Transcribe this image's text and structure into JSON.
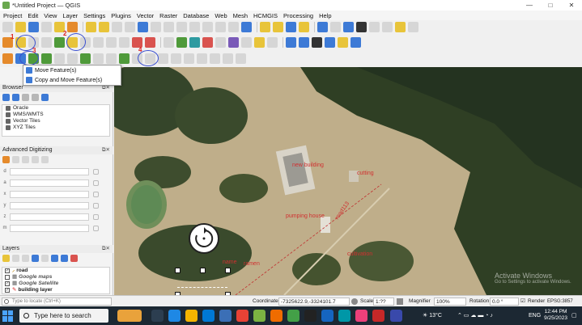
{
  "window": {
    "title": "*Untitled Project — QGIS",
    "controls": [
      "—",
      "□",
      "✕"
    ]
  },
  "menu": [
    "Project",
    "Edit",
    "View",
    "Layer",
    "Settings",
    "Plugins",
    "Vector",
    "Raster",
    "Database",
    "Web",
    "Mesh",
    "HCMGIS",
    "Processing",
    "Help"
  ],
  "toolbar_marks": [
    "1",
    "2",
    "3",
    "4"
  ],
  "toolbar_text": {
    "abc": "abc"
  },
  "dropdown": {
    "items": [
      "Move Feature(s)",
      "Copy and Move Feature(s)"
    ]
  },
  "panels": {
    "browser": {
      "title": "Browser",
      "items": [
        "Oracle",
        "WMS/WMTS",
        "Vector Tiles",
        "XYZ Tiles"
      ]
    },
    "advanced_digitizing": {
      "title": "Advanced Digitizing",
      "rows": [
        "d",
        "a",
        "x",
        "y",
        "z",
        "m"
      ]
    },
    "layers": {
      "title": "Layers",
      "items": [
        {
          "name": "road",
          "checked": true,
          "style": "bold"
        },
        {
          "name": "Google maps",
          "checked": false,
          "style": "italic"
        },
        {
          "name": "Google Satellite",
          "checked": true,
          "style": "italic"
        },
        {
          "name": "building layer",
          "checked": true,
          "style": "bold"
        }
      ]
    }
  },
  "map_labels": [
    "new building",
    "cutting",
    "pumping house",
    "road113",
    "cultivation",
    "name",
    "ramen"
  ],
  "status": {
    "locate_placeholder": "Type to locate (Ctrl+K)",
    "coordinate_label": "Coordinate",
    "coordinate": "-7325622.9,-3324101.7",
    "scale_label": "Scale",
    "scale": "1:??",
    "magnifier_label": "Magnifier",
    "magnifier": "100%",
    "rotation_label": "Rotation",
    "rotation": "0.0 °",
    "render_label": "Render",
    "crs": "EPSG:3857"
  },
  "taskbar": {
    "search_placeholder": "Type here to search",
    "weather": "13°C",
    "language": "ENG",
    "time": "12:44 PM",
    "date": "9/25/2023"
  },
  "watermark": [
    "Activate Windows",
    "Go to Settings to activate Windows."
  ],
  "colors": {
    "accent_circle": "#3a4fd0",
    "label_red": "#d03030",
    "taskbar": "#1c2833"
  }
}
